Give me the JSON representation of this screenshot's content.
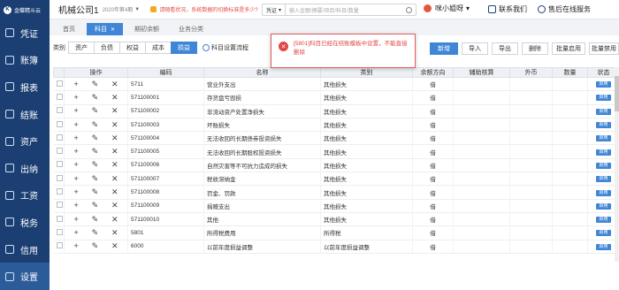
{
  "app": {
    "logo_text": "金蝶精斗云"
  },
  "sidebar": {
    "items": [
      {
        "label": "凭证"
      },
      {
        "label": "账簿"
      },
      {
        "label": "报表"
      },
      {
        "label": "结账"
      },
      {
        "label": "资产"
      },
      {
        "label": "出纳"
      },
      {
        "label": "工资"
      },
      {
        "label": "税务"
      },
      {
        "label": "信用"
      },
      {
        "label": "设置"
      }
    ]
  },
  "header": {
    "company": "机械公司1",
    "period": "2020年第4期",
    "notice": "请随看状况，系统数据的切换标准是多少?",
    "search_category": "凭证",
    "search_placeholder": "输入金额/摘要/项目/科目/数量",
    "user": "咪小姐呀",
    "contact": "联系我们",
    "service": "售后在线服务"
  },
  "tabs": [
    {
      "label": "首页"
    },
    {
      "label": "科目"
    },
    {
      "label": "期初余额"
    },
    {
      "label": "业务分类"
    }
  ],
  "toolbar": {
    "category_label": "类别",
    "categories": [
      "资产",
      "负债",
      "权益",
      "成本",
      "损益"
    ],
    "flow_label": "科目设置流程",
    "buttons": [
      "新增",
      "导入",
      "导出",
      "删除",
      "批量启用",
      "批量禁用"
    ]
  },
  "toast": {
    "message": "[5801]科目已经在结账模板中设置，不能直接删除"
  },
  "table": {
    "headers": [
      "操作",
      "编码",
      "名称",
      "类别",
      "余额方向",
      "辅助核算",
      "外币",
      "数量",
      "状态"
    ],
    "rows": [
      {
        "code": "5711",
        "name": "营业外支出",
        "category": "其他损失",
        "direction": "借",
        "status": "启用"
      },
      {
        "code": "571100001",
        "name": "存货盘亏毁损",
        "category": "其他损失",
        "direction": "借",
        "status": "启用"
      },
      {
        "code": "571100002",
        "name": "非流动资产处置净损失",
        "category": "其他损失",
        "direction": "借",
        "status": "启用"
      },
      {
        "code": "571100003",
        "name": "坏账损失",
        "category": "其他损失",
        "direction": "借",
        "status": "启用"
      },
      {
        "code": "571100004",
        "name": "无法收回的长期债券投资损失",
        "category": "其他损失",
        "direction": "借",
        "status": "启用"
      },
      {
        "code": "571100005",
        "name": "无法收回的长期股权投资损失",
        "category": "其他损失",
        "direction": "借",
        "status": "启用"
      },
      {
        "code": "571100006",
        "name": "自然灾害等不可抗力造成的损失",
        "category": "其他损失",
        "direction": "借",
        "status": "启用"
      },
      {
        "code": "571100007",
        "name": "税收滞纳金",
        "category": "其他损失",
        "direction": "借",
        "status": "启用"
      },
      {
        "code": "571100008",
        "name": "罚金、罚款",
        "category": "其他损失",
        "direction": "借",
        "status": "启用"
      },
      {
        "code": "571100009",
        "name": "捐赠支出",
        "category": "其他损失",
        "direction": "借",
        "status": "启用"
      },
      {
        "code": "571100010",
        "name": "其他",
        "category": "其他损失",
        "direction": "借",
        "status": "启用"
      },
      {
        "code": "5801",
        "name": "所得税费用",
        "category": "所得税",
        "direction": "借",
        "status": "启用"
      },
      {
        "code": "6000",
        "name": "以前年度损益调整",
        "category": "以前年度损益调整",
        "direction": "借",
        "status": "启用"
      }
    ]
  }
}
